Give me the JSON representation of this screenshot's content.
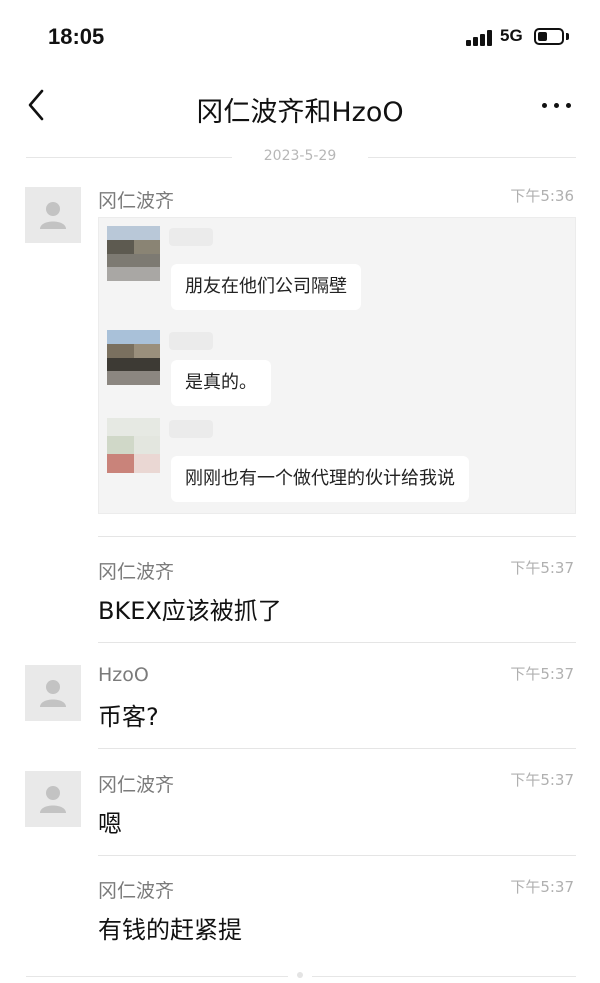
{
  "status_bar": {
    "time": "18:05",
    "network": "5G"
  },
  "nav": {
    "title": "冈仁波齐和HzoO"
  },
  "date_divider": "2023-5-29",
  "messages": [
    {
      "sender": "冈仁波齐",
      "time": "下午5:36",
      "type": "forwarded",
      "forwarded": [
        {
          "text": "朋友在他们公司隔壁"
        },
        {
          "text": "是真的。"
        },
        {
          "text": "刚刚也有一个做代理的伙计给我说"
        }
      ]
    },
    {
      "sender": "冈仁波齐",
      "time": "下午5:37",
      "text": "BKEX应该被抓了"
    },
    {
      "sender": "HzoO",
      "time": "下午5:37",
      "text": "币客?"
    },
    {
      "sender": "冈仁波齐",
      "time": "下午5:37",
      "text": "嗯"
    },
    {
      "sender": "冈仁波齐",
      "time": "下午5:37",
      "text": "有钱的赶紧提"
    }
  ],
  "icons": {
    "back": "chevron-left-icon",
    "more": "more-dots-icon",
    "avatar": "default-user-icon"
  },
  "colors": {
    "meta_text": "#b0b0b0",
    "avatar_bg": "#e9e9e9",
    "card_bg": "#f4f4f4"
  }
}
